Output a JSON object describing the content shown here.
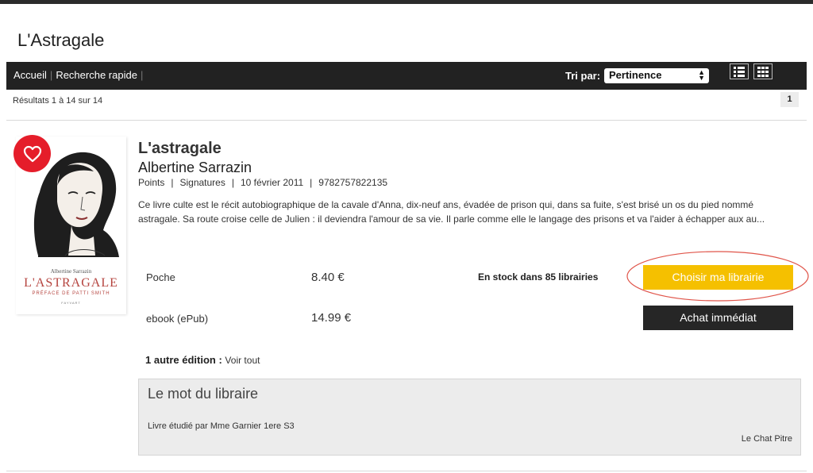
{
  "site": {
    "title": "L'Astragale"
  },
  "nav": {
    "links": [
      "Accueil",
      "Recherche rapide"
    ],
    "sort_label": "Tri par:",
    "sort_value": "Pertinence"
  },
  "results": {
    "text": "Résultats 1 à 14 sur 14",
    "page": "1"
  },
  "book": {
    "title": "L'astragale",
    "author": "Albertine Sarrazin",
    "publisher": "Points",
    "collection": "Signatures",
    "date": "10 février 2011",
    "isbn": "9782757822135",
    "description": "Ce livre culte est le récit autobiographique de la cavale d'Anna, dix-neuf ans, évadée de prison qui, dans sa fuite, s'est brisé un os du pied nommé astragale. Sa route croise celle de Julien : il deviendra l'amour de sa vie. Il parle comme elle le langage des prisons et va l'aider à échapper aux au...",
    "cover": {
      "author": "Albertine Sarrazin",
      "title": "L'ASTRAGALE",
      "subtitle": "PRÉFACE DE PATTI SMITH",
      "publisher": "FAYVART"
    }
  },
  "formats": [
    {
      "name": "Poche",
      "price": "8.40 €"
    },
    {
      "name": "ebook (ePub)",
      "price": "14.99 €"
    }
  ],
  "stock": "En stock dans 85 librairies",
  "buttons": {
    "choose": "Choisir ma librairie",
    "buy": "Achat immédiat"
  },
  "other_editions": {
    "label": "1 autre édition :",
    "link": "Voir tout"
  },
  "bookseller_note": {
    "title": "Le mot du libraire",
    "text": "Livre étudié par Mme Garnier 1ere S3",
    "signature": "Le Chat Pitre"
  },
  "colors": {
    "accent_yellow": "#f5c000",
    "heart_red": "#e51d2a",
    "nav_dark": "#222222",
    "annotation_red": "#e0554a"
  }
}
